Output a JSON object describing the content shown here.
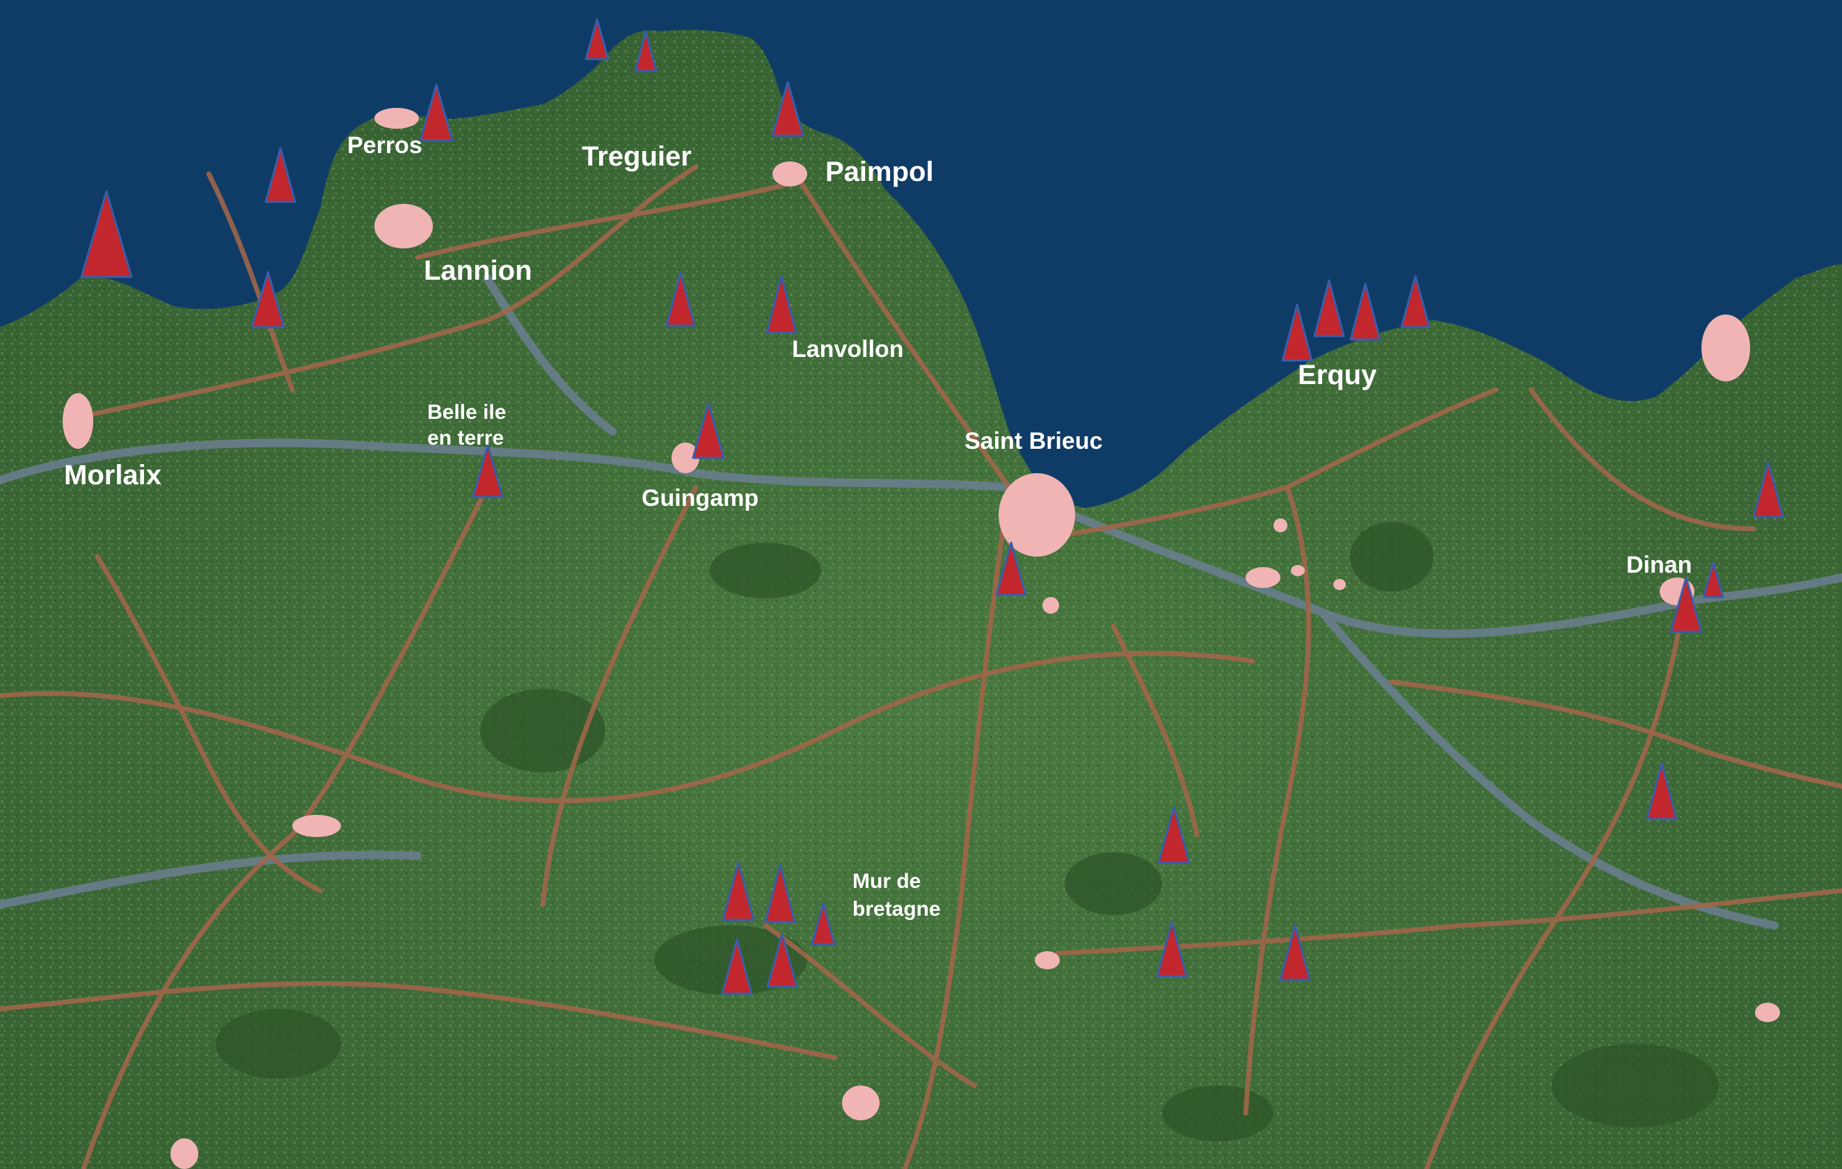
{
  "map": {
    "colors": {
      "sea": "#0f3c66",
      "land": "#3f6f3a",
      "road": "#a0664a",
      "river": "#6b7f92",
      "town": "#f0b4b4",
      "marker": "#c1272d",
      "marker_outline": "#3b5da8",
      "label": "#ffffff"
    },
    "marker_icon": "red-triangle-marker",
    "cities": {
      "perros": "Perros",
      "treguier": "Treguier",
      "paimpol": "Paimpol",
      "lannion": "Lannion",
      "lanvollon": "Lanvollon",
      "erquy": "Erquy",
      "belle_ile_line1": "Belle ile",
      "belle_ile_line2": "en terre",
      "morlaix": "Morlaix",
      "saint_brieuc": "Saint Brieuc",
      "guingamp": "Guingamp",
      "dinan": "Dinan",
      "mur_line1": "Mur de",
      "mur_line2": "bretagne"
    }
  }
}
